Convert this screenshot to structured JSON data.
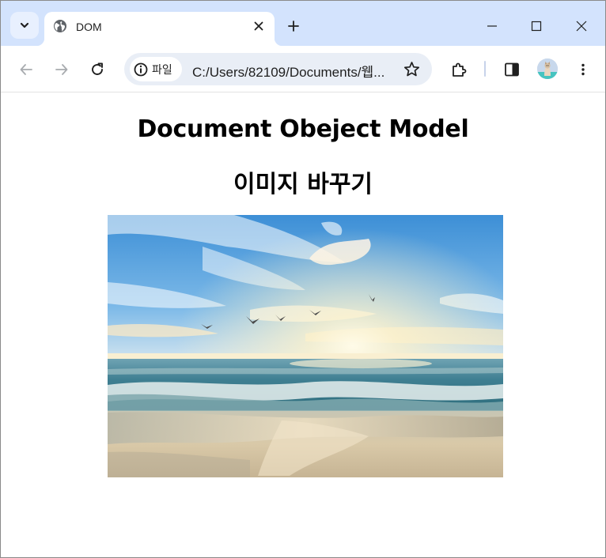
{
  "browser": {
    "tab": {
      "title": "DOM"
    },
    "address": {
      "site_label": "파일",
      "url": "C:/Users/82109/Documents/웹..."
    },
    "icons": {
      "tab_search": "chevron-down-icon",
      "favicon": "globe-icon",
      "close": "close-icon",
      "new_tab": "plus-icon",
      "minimize": "minimize-icon",
      "maximize": "maximize-icon",
      "window_close": "close-icon",
      "back": "back-arrow-icon",
      "forward": "forward-arrow-icon",
      "reload": "reload-icon",
      "info": "info-icon",
      "bookmark": "star-icon",
      "extensions": "puzzle-icon",
      "side_panel": "side-panel-icon",
      "menu": "kebab-menu-icon"
    },
    "colors": {
      "tab_strip": "#d3e3fd",
      "omnibox": "#e9eef6"
    }
  },
  "page": {
    "heading": "Document Obeject Model",
    "subheading": "이미지 바꾸기",
    "image": {
      "subject": "beach-sunset-with-seagulls"
    }
  }
}
